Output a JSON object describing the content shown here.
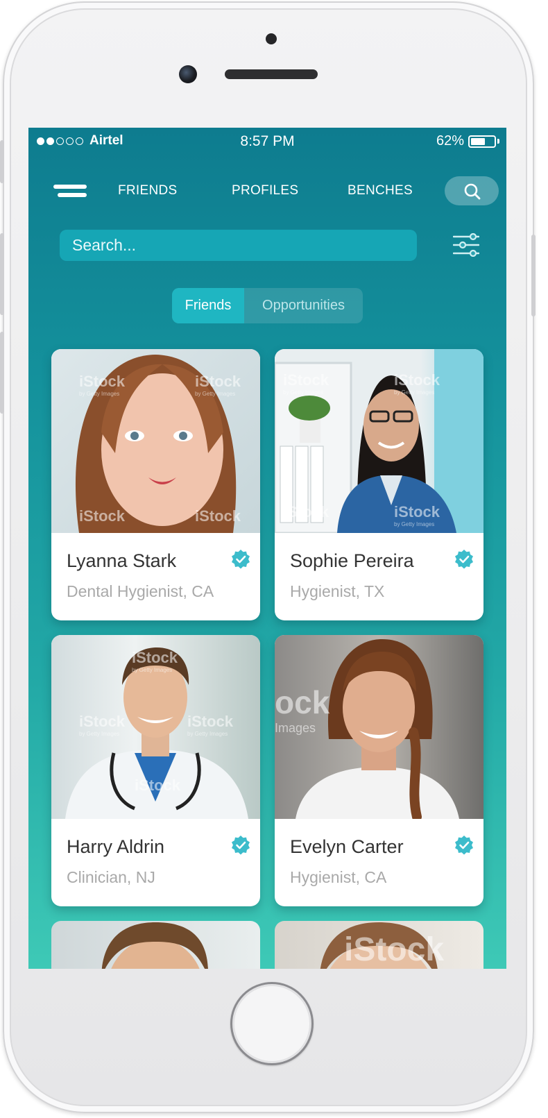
{
  "status_bar": {
    "carrier": "Airtel",
    "time": "8:57 PM",
    "battery": "62%",
    "battery_level": 0.62,
    "signal_bars": 2
  },
  "nav": {
    "tabs": [
      "FRIENDS",
      "PROFILES",
      "BENCHES"
    ]
  },
  "search": {
    "placeholder": "Search..."
  },
  "segments": {
    "active": "Friends",
    "inactive": "Opportunities"
  },
  "watermark": {
    "brand": "iStock",
    "sub": "by Getty Images"
  },
  "cards": [
    {
      "name": "Lyanna Stark",
      "role": "Dental Hygienist, CA",
      "verified": true
    },
    {
      "name": "Sophie Pereira",
      "role": "Hygienist, TX",
      "verified": true
    },
    {
      "name": "Harry Aldrin",
      "role": "Clinician, NJ",
      "verified": true
    },
    {
      "name": "Evelyn Carter",
      "role": "Hygienist, CA",
      "verified": true
    }
  ],
  "colors": {
    "accent": "#1fb6c2",
    "badge": "#3cbccb",
    "gradient_top": "#0e7c8f",
    "gradient_bottom": "#3ec9b6"
  },
  "icons": [
    "menu-icon",
    "search-icon",
    "filter-icon",
    "verified-badge-icon",
    "battery-icon"
  ]
}
